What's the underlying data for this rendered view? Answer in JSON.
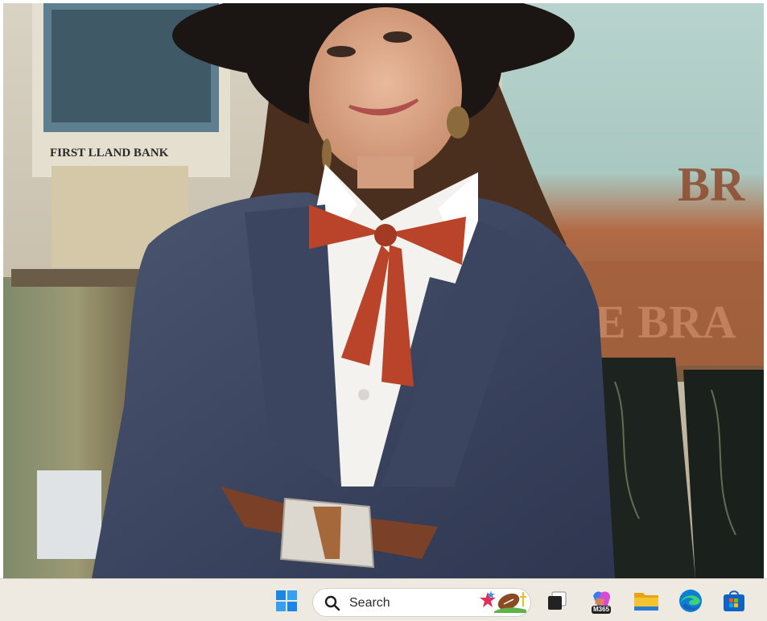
{
  "wallpaper": {
    "poster_text": "FIRST LLAND BANK",
    "sign_text_1": "BR",
    "sign_text_2": "E BRA"
  },
  "taskbar": {
    "search": {
      "label": "Search"
    },
    "m365_badge": "M365",
    "icons": [
      "windows-start-icon",
      "search-icon",
      "football-icon",
      "task-view-icon",
      "m365-copilot-icon",
      "file-explorer-icon",
      "edge-icon",
      "store-icon"
    ]
  },
  "colors": {
    "taskbar_bg": "#eeeae2",
    "start_blue": "#1a86e8",
    "folder_yellow": "#f4c430",
    "edge_blue": "#0a7fd4",
    "store_blue": "#0f62c6"
  }
}
